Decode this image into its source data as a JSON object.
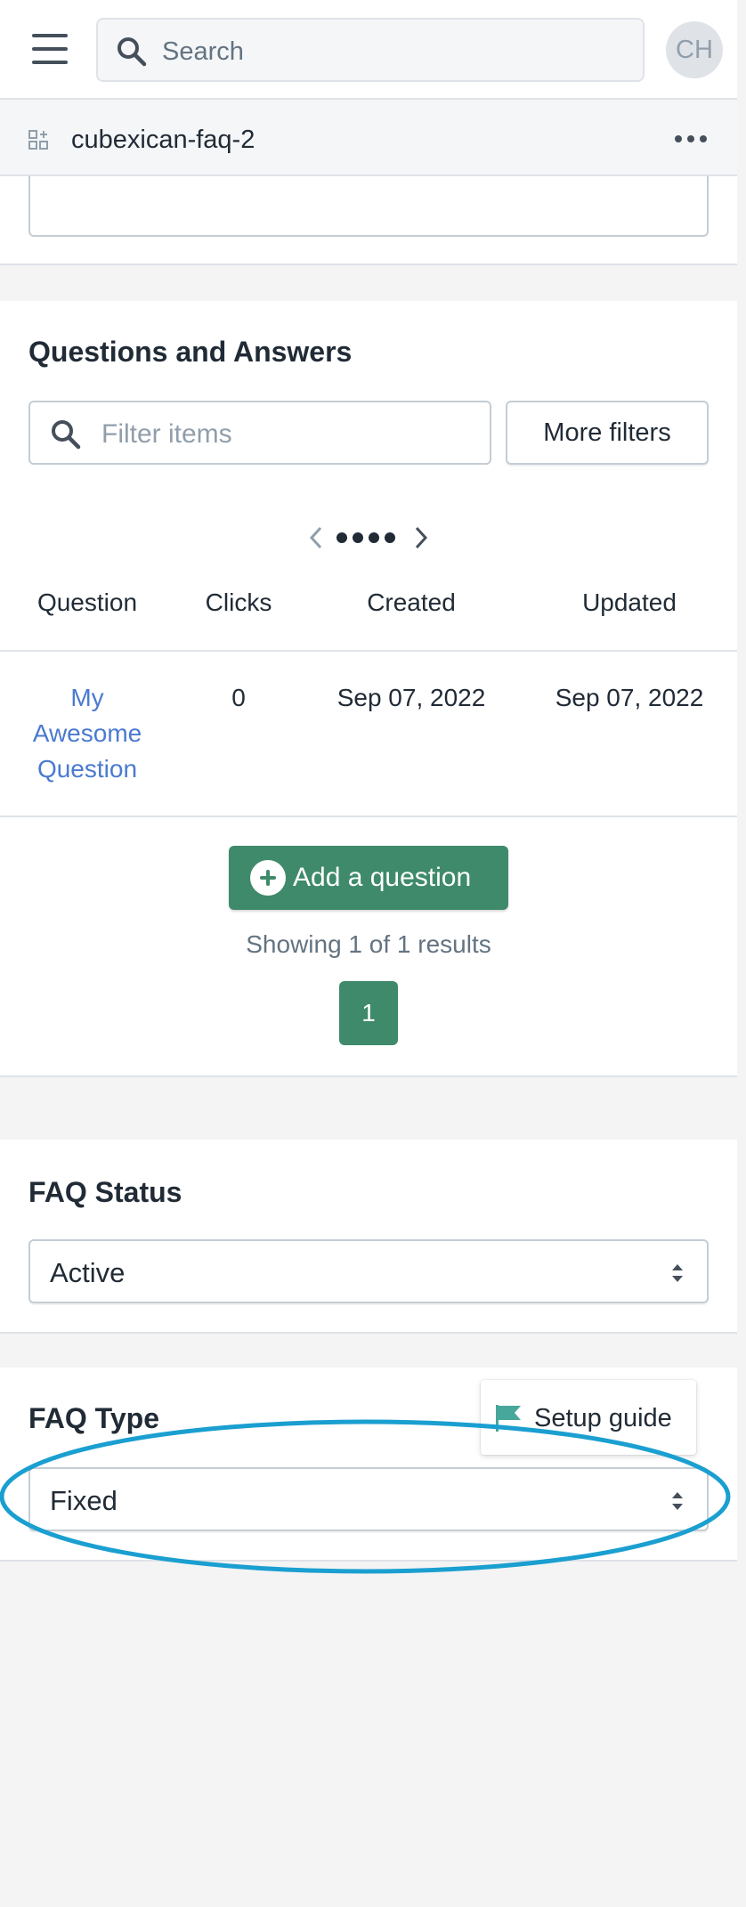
{
  "topbar": {
    "search_placeholder": "Search",
    "avatar_initials": "CH"
  },
  "app": {
    "name": "cubexican-faq-2"
  },
  "qa_section": {
    "title": "Questions and Answers",
    "filter_placeholder": "Filter items",
    "more_filters_label": "More filters",
    "columns": [
      "Question",
      "Clicks",
      "Created",
      "Updated"
    ],
    "rows": [
      {
        "question": "My Awesome Question",
        "clicks": "0",
        "created": "Sep 07, 2022",
        "updated": "Sep 07, 2022"
      }
    ],
    "add_question_label": "Add a question",
    "results_text": "Showing 1 of 1 results",
    "current_page": "1"
  },
  "status_section": {
    "title": "FAQ Status",
    "selected": "Active"
  },
  "type_section": {
    "title": "FAQ Type",
    "selected": "Fixed",
    "setup_guide_label": "Setup guide"
  },
  "colors": {
    "primary": "#3f8a6b",
    "link": "#4a7ad0",
    "highlight": "#1a9fd0",
    "flag": "#47a79a"
  }
}
